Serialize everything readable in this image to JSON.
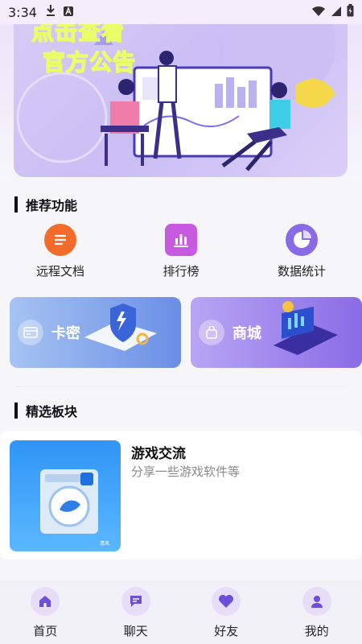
{
  "status_bar": {
    "time": "3:34",
    "icons": [
      "download-icon",
      "app-badge-icon",
      "wifi-icon",
      "signal-icon",
      "battery-icon"
    ]
  },
  "banner": {
    "line1": "点击查看",
    "line2": "官方公告"
  },
  "sections": {
    "recommended": "推荐功能",
    "featured": "精选板块"
  },
  "features": [
    {
      "label": "远程文档",
      "icon": "document-icon",
      "color": "#f26b2b"
    },
    {
      "label": "排行榜",
      "icon": "bar-chart-icon",
      "color": "#c85ae0"
    },
    {
      "label": "数据统计",
      "icon": "pie-chart-icon",
      "color": "#8a6be6"
    }
  ],
  "cards": [
    {
      "label": "卡密",
      "icon": "card-icon",
      "gradient": [
        "#a6c3f2",
        "#6b8ee6"
      ]
    },
    {
      "label": "商城",
      "icon": "shopping-bag-icon",
      "gradient": [
        "#b7a6f4",
        "#8a6be6"
      ]
    }
  ],
  "featured_block": {
    "title": "游戏交流",
    "description": "分享一些游戏软件等"
  },
  "bottom_nav": [
    {
      "label": "首页",
      "icon": "home-icon"
    },
    {
      "label": "聊天",
      "icon": "chat-icon"
    },
    {
      "label": "好友",
      "icon": "heart-icon"
    },
    {
      "label": "我的",
      "icon": "user-icon"
    }
  ],
  "colors": {
    "accent": "#6b4fd8",
    "nav_icon_bg": "#e6def8"
  }
}
